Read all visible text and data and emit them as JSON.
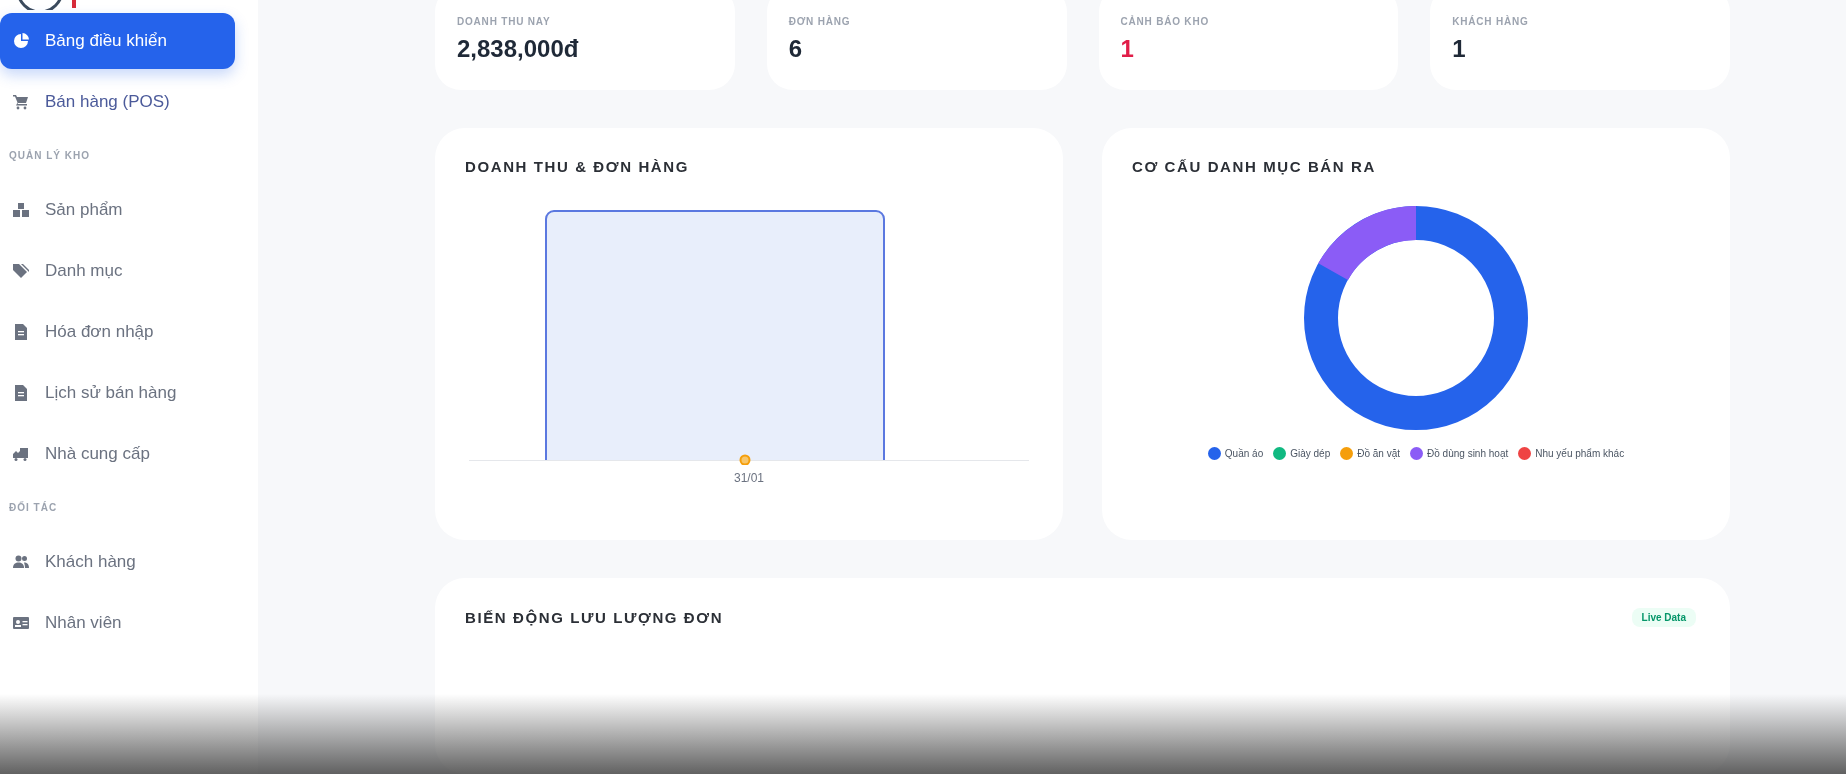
{
  "sidebar": {
    "items": [
      {
        "kind": "link",
        "label": "Bảng điều khiển",
        "selected": true
      },
      {
        "kind": "link",
        "label": "Bán hàng (POS)",
        "selected": false
      },
      {
        "kind": "section",
        "label": "QUẢN LÝ KHO"
      },
      {
        "kind": "link",
        "label": "Sản phẩm",
        "selected": false
      },
      {
        "kind": "link",
        "label": "Danh mục",
        "selected": false
      },
      {
        "kind": "link",
        "label": "Hóa đơn nhập",
        "selected": false
      },
      {
        "kind": "link",
        "label": "Lịch sử bán hàng",
        "selected": false
      },
      {
        "kind": "link",
        "label": "Nhà cung cấp",
        "selected": false
      },
      {
        "kind": "section",
        "label": "ĐỐI TÁC"
      },
      {
        "kind": "link",
        "label": "Khách hàng",
        "selected": false
      },
      {
        "kind": "link",
        "label": "Nhân viên",
        "selected": false
      }
    ]
  },
  "stats": [
    {
      "label": "DOANH THU NAY",
      "value": "2,838,000đ",
      "alert": false
    },
    {
      "label": "ĐƠN HÀNG",
      "value": "6",
      "alert": false
    },
    {
      "label": "CẢNH BÁO KHO",
      "value": "1",
      "alert": true
    },
    {
      "label": "KHÁCH HÀNG",
      "value": "1",
      "alert": false
    }
  ],
  "revenue_chart": {
    "title": "DOANH THU & ĐƠN HÀNG",
    "x_label": "31/01"
  },
  "category_chart": {
    "title": "CƠ CẤU DANH MỤC BÁN RA",
    "legend": [
      {
        "label": "Quần áo",
        "color": "#2563eb"
      },
      {
        "label": "Giày dép",
        "color": "#10b981"
      },
      {
        "label": "Đồ ăn vặt",
        "color": "#f59e0b"
      },
      {
        "label": "Đồ dùng sinh hoạt",
        "color": "#8b5cf6"
      },
      {
        "label": "Nhu yếu phẩm khác",
        "color": "#ef4444"
      }
    ]
  },
  "traffic_panel": {
    "title": "BIẾN ĐỘNG LƯU LƯỢNG ĐƠN",
    "badge": "Live Data"
  }
}
